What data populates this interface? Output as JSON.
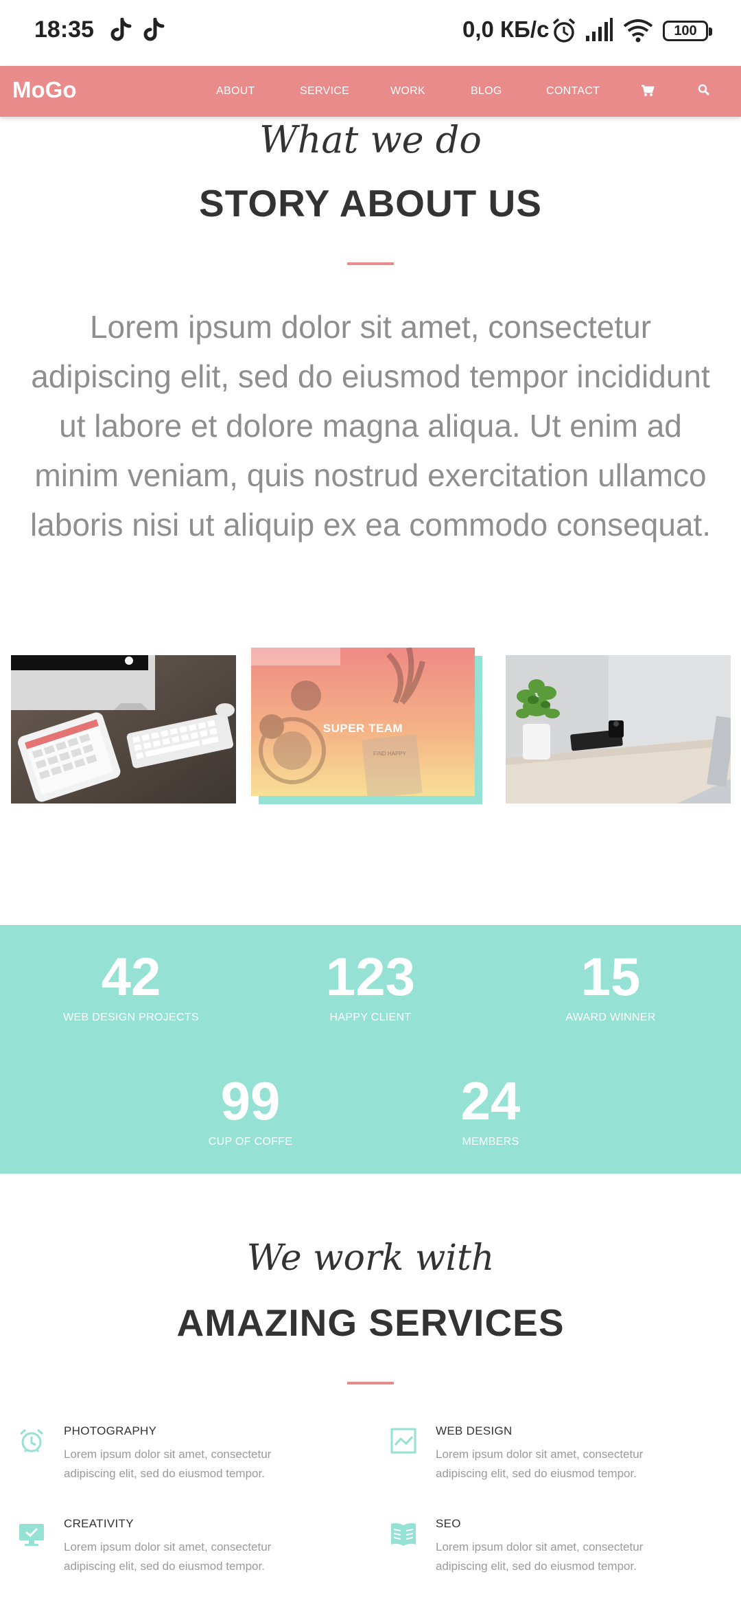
{
  "status_bar": {
    "time": "18:35",
    "speed": "0,0 КБ/с",
    "battery": "100",
    "icons": [
      "tiktok-icon",
      "tiktok-icon",
      "alarm-icon",
      "signal-icon",
      "wifi-icon",
      "battery-icon"
    ]
  },
  "nav": {
    "logo": "MoGo",
    "items": [
      "ABOUT",
      "SERVICE",
      "WORK",
      "BLOG",
      "CONTACT"
    ],
    "icons": [
      "cart-icon",
      "search-icon"
    ]
  },
  "about": {
    "script": "What we do",
    "heading": "STORY ABOUT US",
    "text": "Lorem ipsum dolor sit amet, consectetur adipiscing elit, sed do eiusmod tempor incididunt ut labore et dolore magna aliqua. Ut enim ad minim veniam, quis nostrud exercitation ullamco laboris nisi ut aliquip ex ea commodo consequat."
  },
  "gallery": {
    "team_label": "SUPER TEAM",
    "team_note": "FIND HAPPY"
  },
  "stats": [
    {
      "number": "42",
      "label": "WEB DESIGN PROJECTS"
    },
    {
      "number": "123",
      "label": "HAPPY CLIENT"
    },
    {
      "number": "15",
      "label": "AWARD WINNER"
    },
    {
      "number": "99",
      "label": "CUP OF COFFE"
    },
    {
      "number": "24",
      "label": "MEMBERS"
    }
  ],
  "services_section": {
    "script": "We work with",
    "heading": "AMAZING SERVICES",
    "items": [
      {
        "title": "PHOTOGRAPHY",
        "text": "Lorem ipsum dolor sit amet, consectetur adipiscing elit, sed do eiusmod tempor.",
        "icon": "alarm-clock-icon"
      },
      {
        "title": "WEB DESIGN",
        "text": "Lorem ipsum dolor sit amet, consectetur adipiscing elit, sed do eiusmod tempor.",
        "icon": "chart-icon"
      },
      {
        "title": "CREATIVITY",
        "text": "Lorem ipsum dolor sit amet, consectetur adipiscing elit, sed do eiusmod tempor.",
        "icon": "monitor-icon"
      },
      {
        "title": "SEO",
        "text": "Lorem ipsum dolor sit amet, consectetur adipiscing elit, sed do eiusmod tempor.",
        "icon": "book-icon"
      }
    ]
  },
  "colors": {
    "accent": "#e98b8b",
    "teal": "#95e1d3"
  }
}
